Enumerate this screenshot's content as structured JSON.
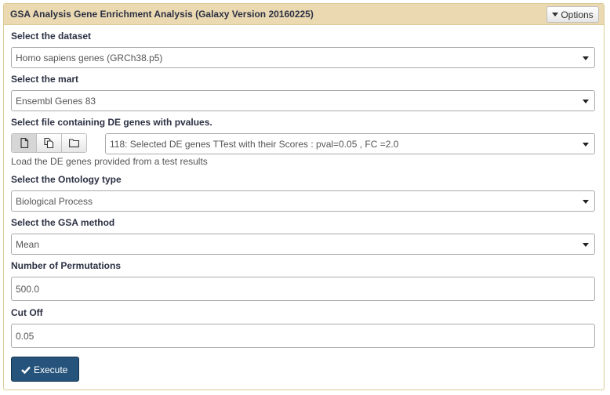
{
  "header": {
    "title": "GSA Analysis Gene Enrichment Analysis (Galaxy Version 20160225)",
    "options_label": "Options"
  },
  "form": {
    "dataset": {
      "label": "Select the dataset",
      "value": "Homo sapiens genes (GRCh38.p5)"
    },
    "mart": {
      "label": "Select the mart",
      "value": "Ensembl Genes 83"
    },
    "de_file": {
      "label": "Select file containing DE genes with pvalues.",
      "value": "118: Selected DE genes TTest with their Scores : pval=0.05 , FC =2.0",
      "help": "Load the DE genes provided from a test results",
      "modes": [
        "single-dataset-icon",
        "multiple-datasets-icon",
        "folder-icon"
      ]
    },
    "ontology": {
      "label": "Select the Ontology type",
      "value": "Biological Process"
    },
    "method": {
      "label": "Select the GSA method",
      "value": "Mean"
    },
    "permutations": {
      "label": "Number of Permutations",
      "value": "500.0"
    },
    "cutoff": {
      "label": "Cut Off",
      "value": "0.05"
    }
  },
  "execute": {
    "label": "Execute"
  },
  "colors": {
    "header_bg": "#ebd9b2",
    "border": "#d9cb97",
    "execute_bg": "#25537b"
  }
}
